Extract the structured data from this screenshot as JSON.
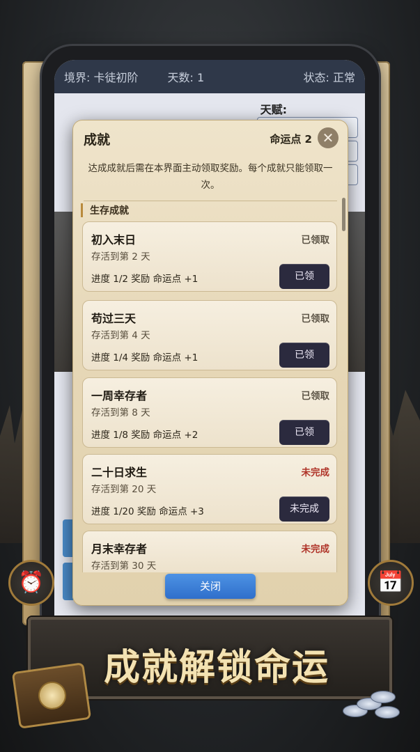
{
  "status_bar": {
    "realm": "境界: 卡徒初阶",
    "days": "天数: 1",
    "state": "状态: 正常"
  },
  "background_panel": {
    "talent_label": "天赋:"
  },
  "modal": {
    "title": "成就",
    "fate_points": "命运点 2",
    "description": "达成成就后需在本界面主动领取奖励。每个成就只能领取一次。",
    "section_title": "生存成就",
    "close_button": "关闭",
    "achievements": [
      {
        "name": "初入末日",
        "state": "已领取",
        "desc": "存活到第 2 天",
        "progress": "进度 1/2  奖励  命运点 +1",
        "button": "已领",
        "done": true
      },
      {
        "name": "苟过三天",
        "state": "已领取",
        "desc": "存活到第 4 天",
        "progress": "进度 1/4  奖励  命运点 +1",
        "button": "已领",
        "done": true
      },
      {
        "name": "一周幸存者",
        "state": "已领取",
        "desc": "存活到第 8 天",
        "progress": "进度 1/8  奖励  命运点 +2",
        "button": "已领",
        "done": true
      },
      {
        "name": "二十日求生",
        "state": "未完成",
        "desc": "存活到第 20 天",
        "progress": "进度 1/20  奖励  命运点 +3",
        "button": "未完成",
        "done": false
      },
      {
        "name": "月末幸存者",
        "state": "未完成",
        "desc": "存活到第 30 天",
        "progress": "",
        "button": "",
        "done": false
      }
    ]
  },
  "banner": {
    "headline": "成就解锁命运"
  },
  "icons": {
    "left_round": "alarm-clock-icon",
    "right_round": "calendar-icon",
    "close": "close-icon"
  },
  "colors": {
    "status_bar": "#2f3849",
    "parchment": "#e6d7b6",
    "claimed_button": "#2b2a3e",
    "incomplete_text": "#b0352a",
    "close_button": "#3a7fd6",
    "headline": "#f3e2b2"
  }
}
